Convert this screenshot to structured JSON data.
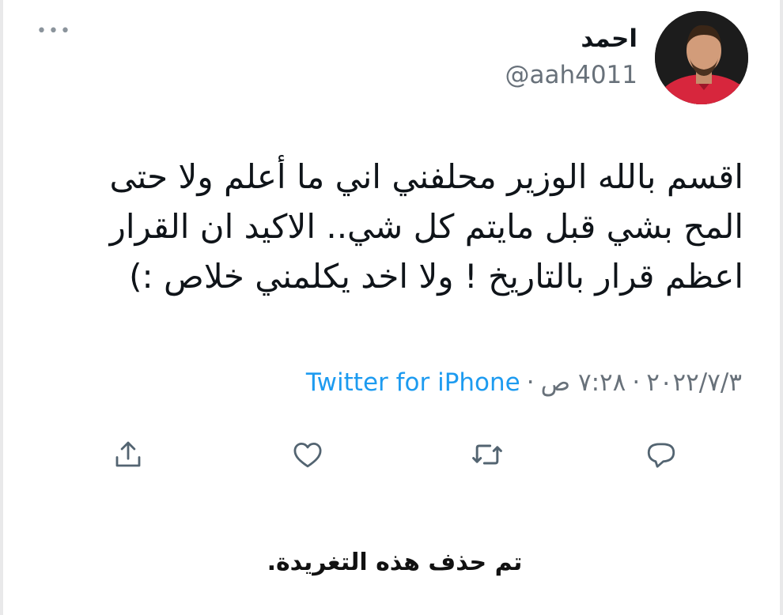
{
  "tweet": {
    "author": {
      "display_name": "احمد",
      "handle": "@aah4011",
      "avatar": "avatar-photo"
    },
    "more_icon": "more-options-icon",
    "text_lines": [
      "اقسم بالله الوزير محلفني اني ما أعلم ولا حتى",
      "المح بشي قبل مايتم كل شي.. الاكيد ان القرار",
      "اعظم قرار  بالتاريخ ! ولا اخد يكلمني خلاص :)"
    ],
    "meta": {
      "date": "٢٠٢٢/٧/٣",
      "time": "٧:٢٨ ص",
      "separator": "·",
      "source": "Twitter for iPhone"
    },
    "actions": [
      {
        "icon": "share-icon"
      },
      {
        "icon": "like-heart-icon"
      },
      {
        "icon": "retweet-icon"
      },
      {
        "icon": "reply-icon"
      }
    ]
  },
  "notice": {
    "deleted_text": "تم حذف هذه التغريدة."
  },
  "colors": {
    "text": "#0f1419",
    "secondary": "#68717a",
    "link": "#1d9bf0",
    "icon": "#536471",
    "avatar_shirt": "#d7263d"
  }
}
